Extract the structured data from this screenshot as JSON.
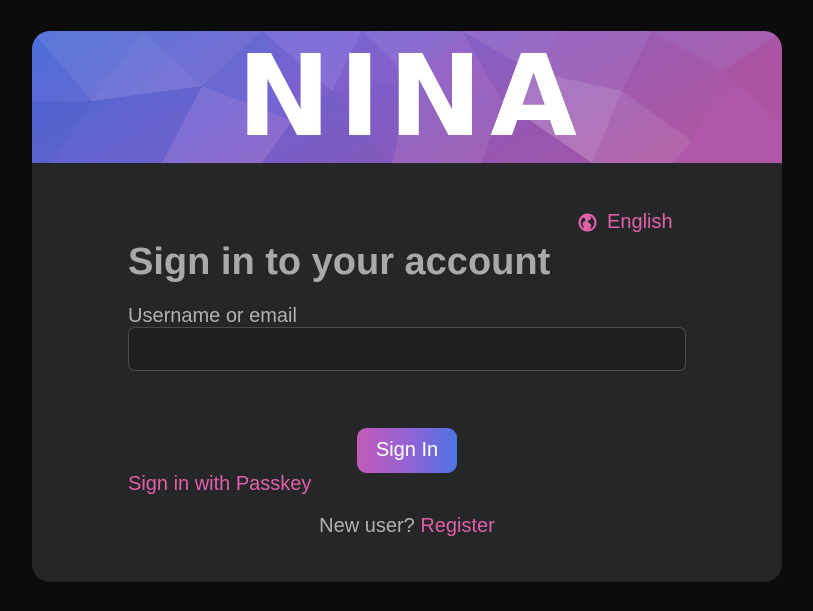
{
  "banner": {
    "logo_text": "NINA",
    "gradient_colors": [
      "#4e6fd6",
      "#7a5fd0",
      "#a85aa0"
    ]
  },
  "language": {
    "icon": "globe-icon",
    "label": "English"
  },
  "login": {
    "title": "Sign in to your account",
    "username_label": "Username or email",
    "username_value": "",
    "username_placeholder": "",
    "submit_label": "Sign In",
    "passkey_link": "Sign in with Passkey",
    "new_user_text": "New user?",
    "register_link": "Register"
  },
  "colors": {
    "background": "#0c0c0e",
    "card": "#252628",
    "accent": "#e060a8",
    "button_gradient": [
      "#c35bb8",
      "#4d74e3"
    ]
  }
}
